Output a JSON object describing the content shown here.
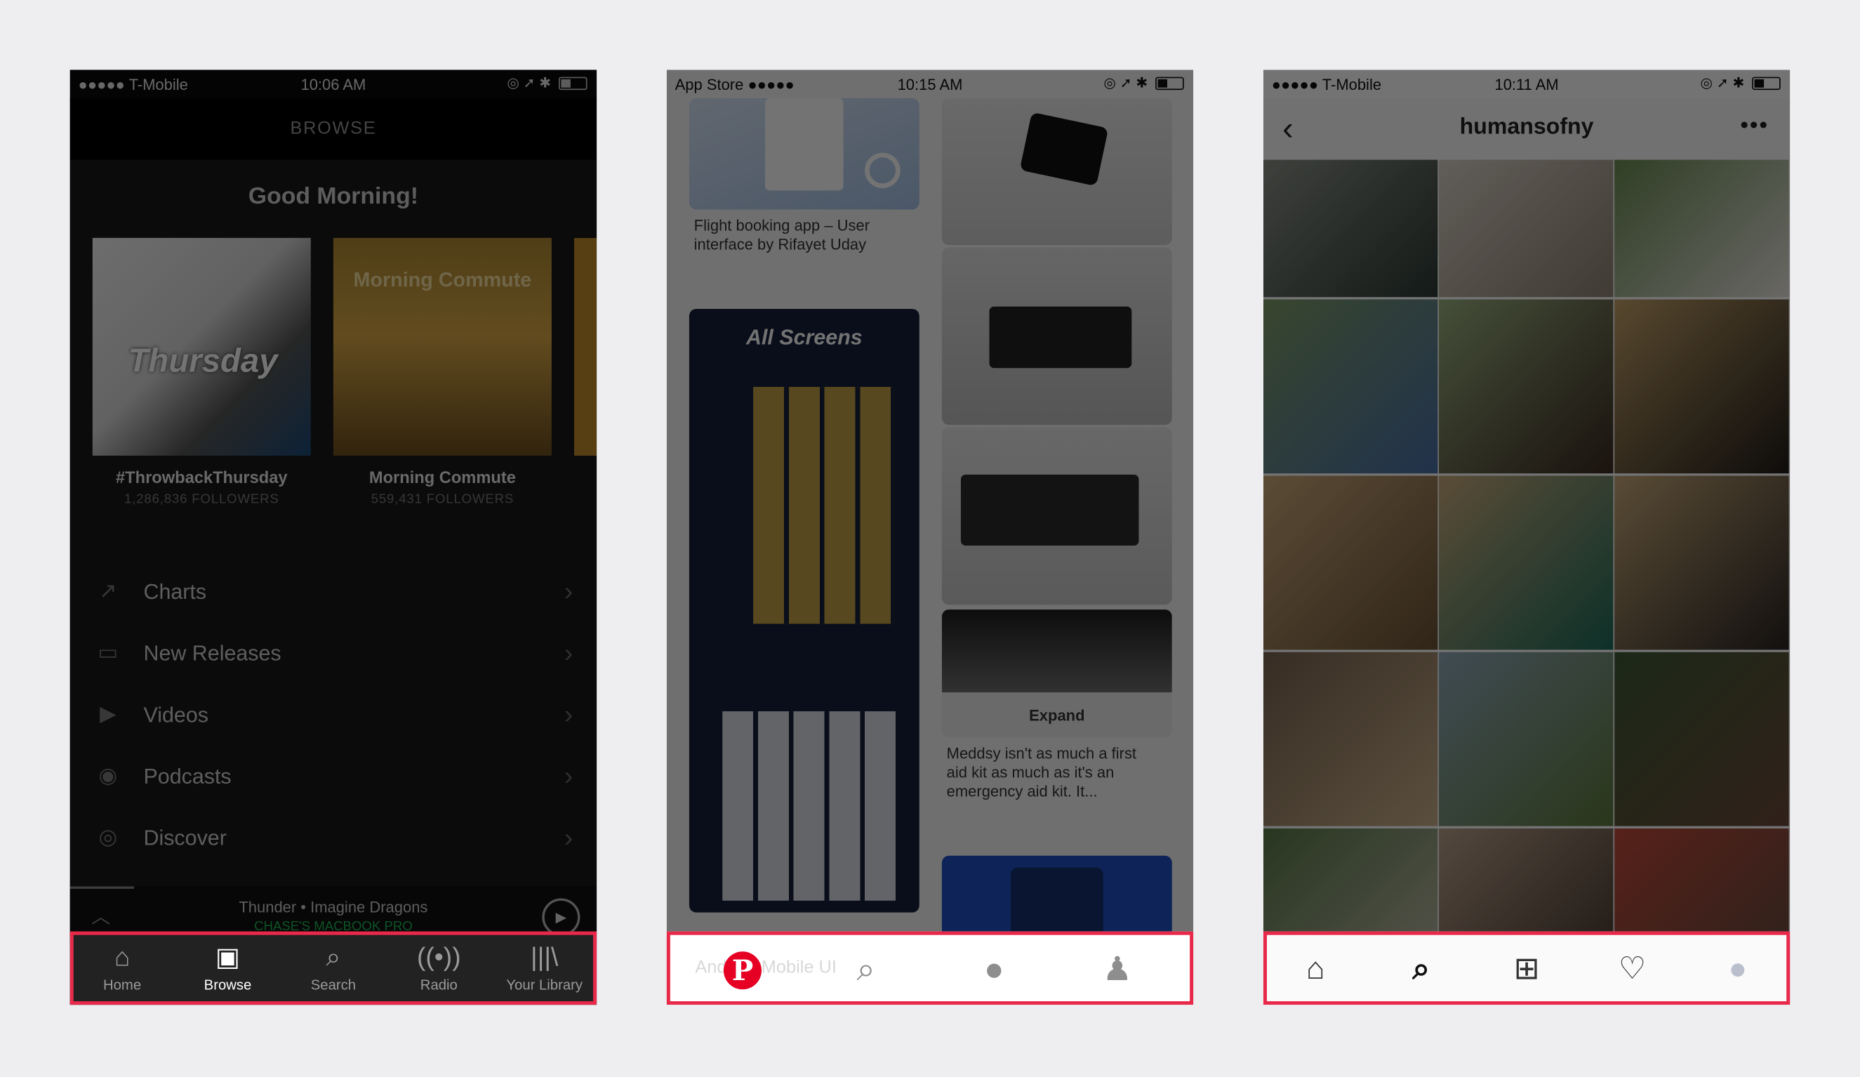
{
  "spotify": {
    "status": {
      "carrier": "●●●●● T-Mobile",
      "time": "10:06 AM"
    },
    "header": "BROWSE",
    "greeting": "Good Morning!",
    "cards": [
      {
        "art_text": "Thursday",
        "title": "#ThrowbackThursday",
        "followers": "1,286,836 FOLLOWERS"
      },
      {
        "art_text": "Morning Commute",
        "title": "Morning Commute",
        "followers": "559,431 FOLLOWERS"
      }
    ],
    "list": [
      "Charts",
      "New Releases",
      "Videos",
      "Podcasts",
      "Discover"
    ],
    "now_playing": {
      "song": "Thunder • Imagine Dragons",
      "device": "CHASE'S MACBOOK PRO"
    },
    "tabs": [
      "Home",
      "Browse",
      "Search",
      "Radio",
      "Your Library"
    ],
    "active_tab": "Browse"
  },
  "pinterest": {
    "status": {
      "carrier": "App Store ●●●●●",
      "time": "10:15 AM"
    },
    "pins": {
      "flight_caption": "Flight booking app – User interface by Rifayet Uday",
      "screens_title": "All Screens",
      "expand": "Expand",
      "meddsy_caption": "Meddsy isn't as much a first aid kit as much as it's an emergency aid kit. It...",
      "ghost_text": "Android Mobile UI"
    },
    "tabs": [
      "pinterest-logo",
      "search",
      "messages",
      "profile"
    ]
  },
  "instagram": {
    "status": {
      "carrier": "●●●●● T-Mobile",
      "time": "10:11 AM"
    },
    "username": "humansofny",
    "tabs": [
      "home",
      "search",
      "add",
      "activity",
      "profile"
    ]
  },
  "colors": {
    "highlight": "#e8294a",
    "spotify_green": "#1db954",
    "pinterest_red": "#e60023"
  }
}
